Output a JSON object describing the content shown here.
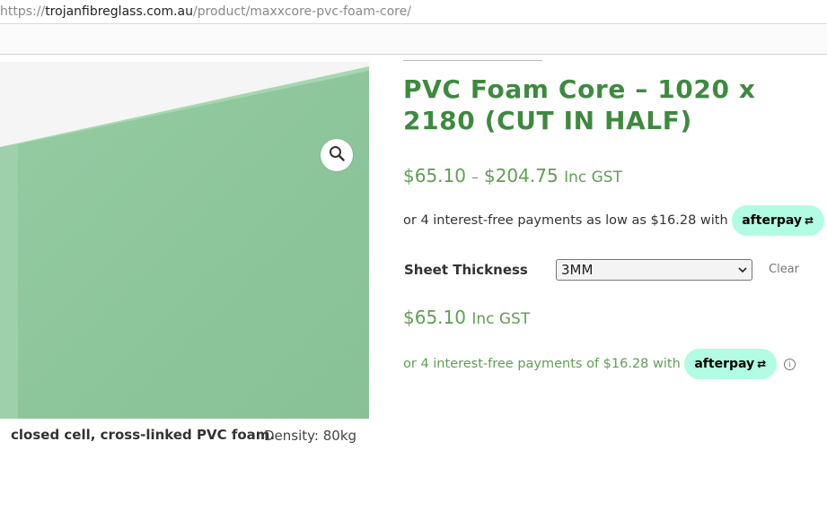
{
  "browser": {
    "url_scheme": "https://",
    "url_host": "trojanfibreglass.com.au",
    "url_path": "/product/maxxcore-pvc-foam-core/"
  },
  "product": {
    "title": "PVC Foam Core – 1020 x 2180 (CUT IN HALF)",
    "price_min": "$65.10",
    "price_separator": "–",
    "price_max": "$204.75",
    "price_suffix": "Inc GST",
    "image_caption_left": "closed cell, cross-linked PVC foam.",
    "image_caption_right": "Density: 80kg",
    "zoom_icon": "magnifier-icon",
    "image_color": "#8cc79a"
  },
  "afterpay_range": {
    "text": "or 4 interest-free payments as low as $16.28 with",
    "badge_label": "afterpay",
    "badge_color": "#b2fce4",
    "info_icon": "ⓘ"
  },
  "variation": {
    "label": "Sheet Thickness",
    "selected": "3MM",
    "clear_label": "Clear",
    "price": "$65.10",
    "price_suffix": "Inc GST"
  },
  "afterpay_variation": {
    "text": "or 4 interest-free payments of $16.28 with",
    "badge_label": "afterpay",
    "info_icon": "ⓘ"
  },
  "colors": {
    "title_green": "#3d8a3f",
    "price_green": "#5ea052"
  }
}
